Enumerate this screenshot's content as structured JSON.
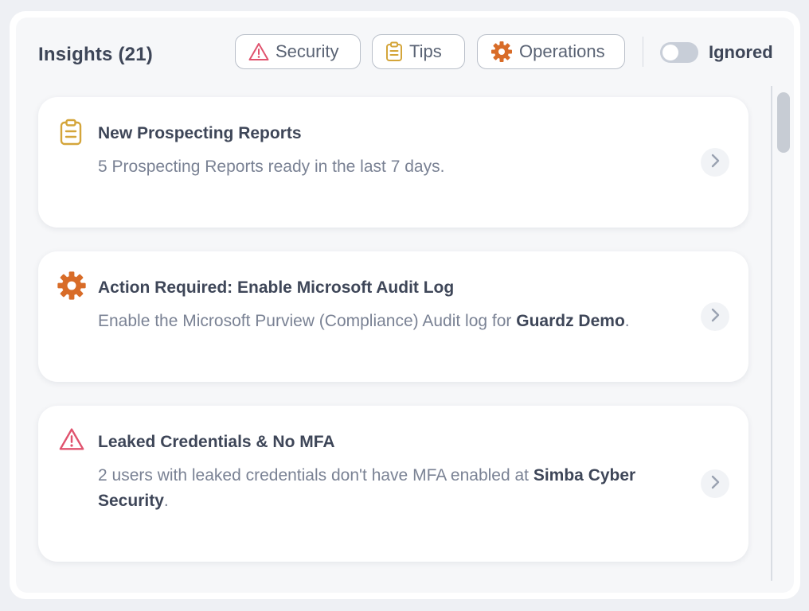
{
  "header": {
    "title": "Insights (21)",
    "filters": [
      {
        "label": "Security",
        "icon": "warning-triangle-icon",
        "color": "#e0536e"
      },
      {
        "label": "Tips",
        "icon": "clipboard-icon",
        "color": "#d4a53a"
      },
      {
        "label": "Operations",
        "icon": "gear-icon",
        "color": "#d86c28"
      }
    ],
    "ignored_toggle": {
      "label": "Ignored",
      "on": false
    }
  },
  "cards": [
    {
      "icon": "clipboard-icon",
      "title": "New Prospecting Reports",
      "desc_parts": [
        "5 Prospecting Reports ready in the last 7 days."
      ]
    },
    {
      "icon": "gear-icon",
      "title": "Action Required: Enable Microsoft Audit Log",
      "desc_parts": [
        "Enable the Microsoft Purview (Compliance) Audit log for ",
        "Guardz Demo",
        "."
      ]
    },
    {
      "icon": "warning-triangle-icon",
      "title": "Leaked Credentials & No MFA",
      "desc_parts": [
        "2 users with leaked credentials don't have MFA enabled at ",
        "Simba Cyber Security",
        "."
      ]
    }
  ],
  "colors": {
    "text": "#3e4658",
    "muted": "#7a8294",
    "security": "#e0536e",
    "tips": "#d4a53a",
    "operations": "#d86c28"
  }
}
